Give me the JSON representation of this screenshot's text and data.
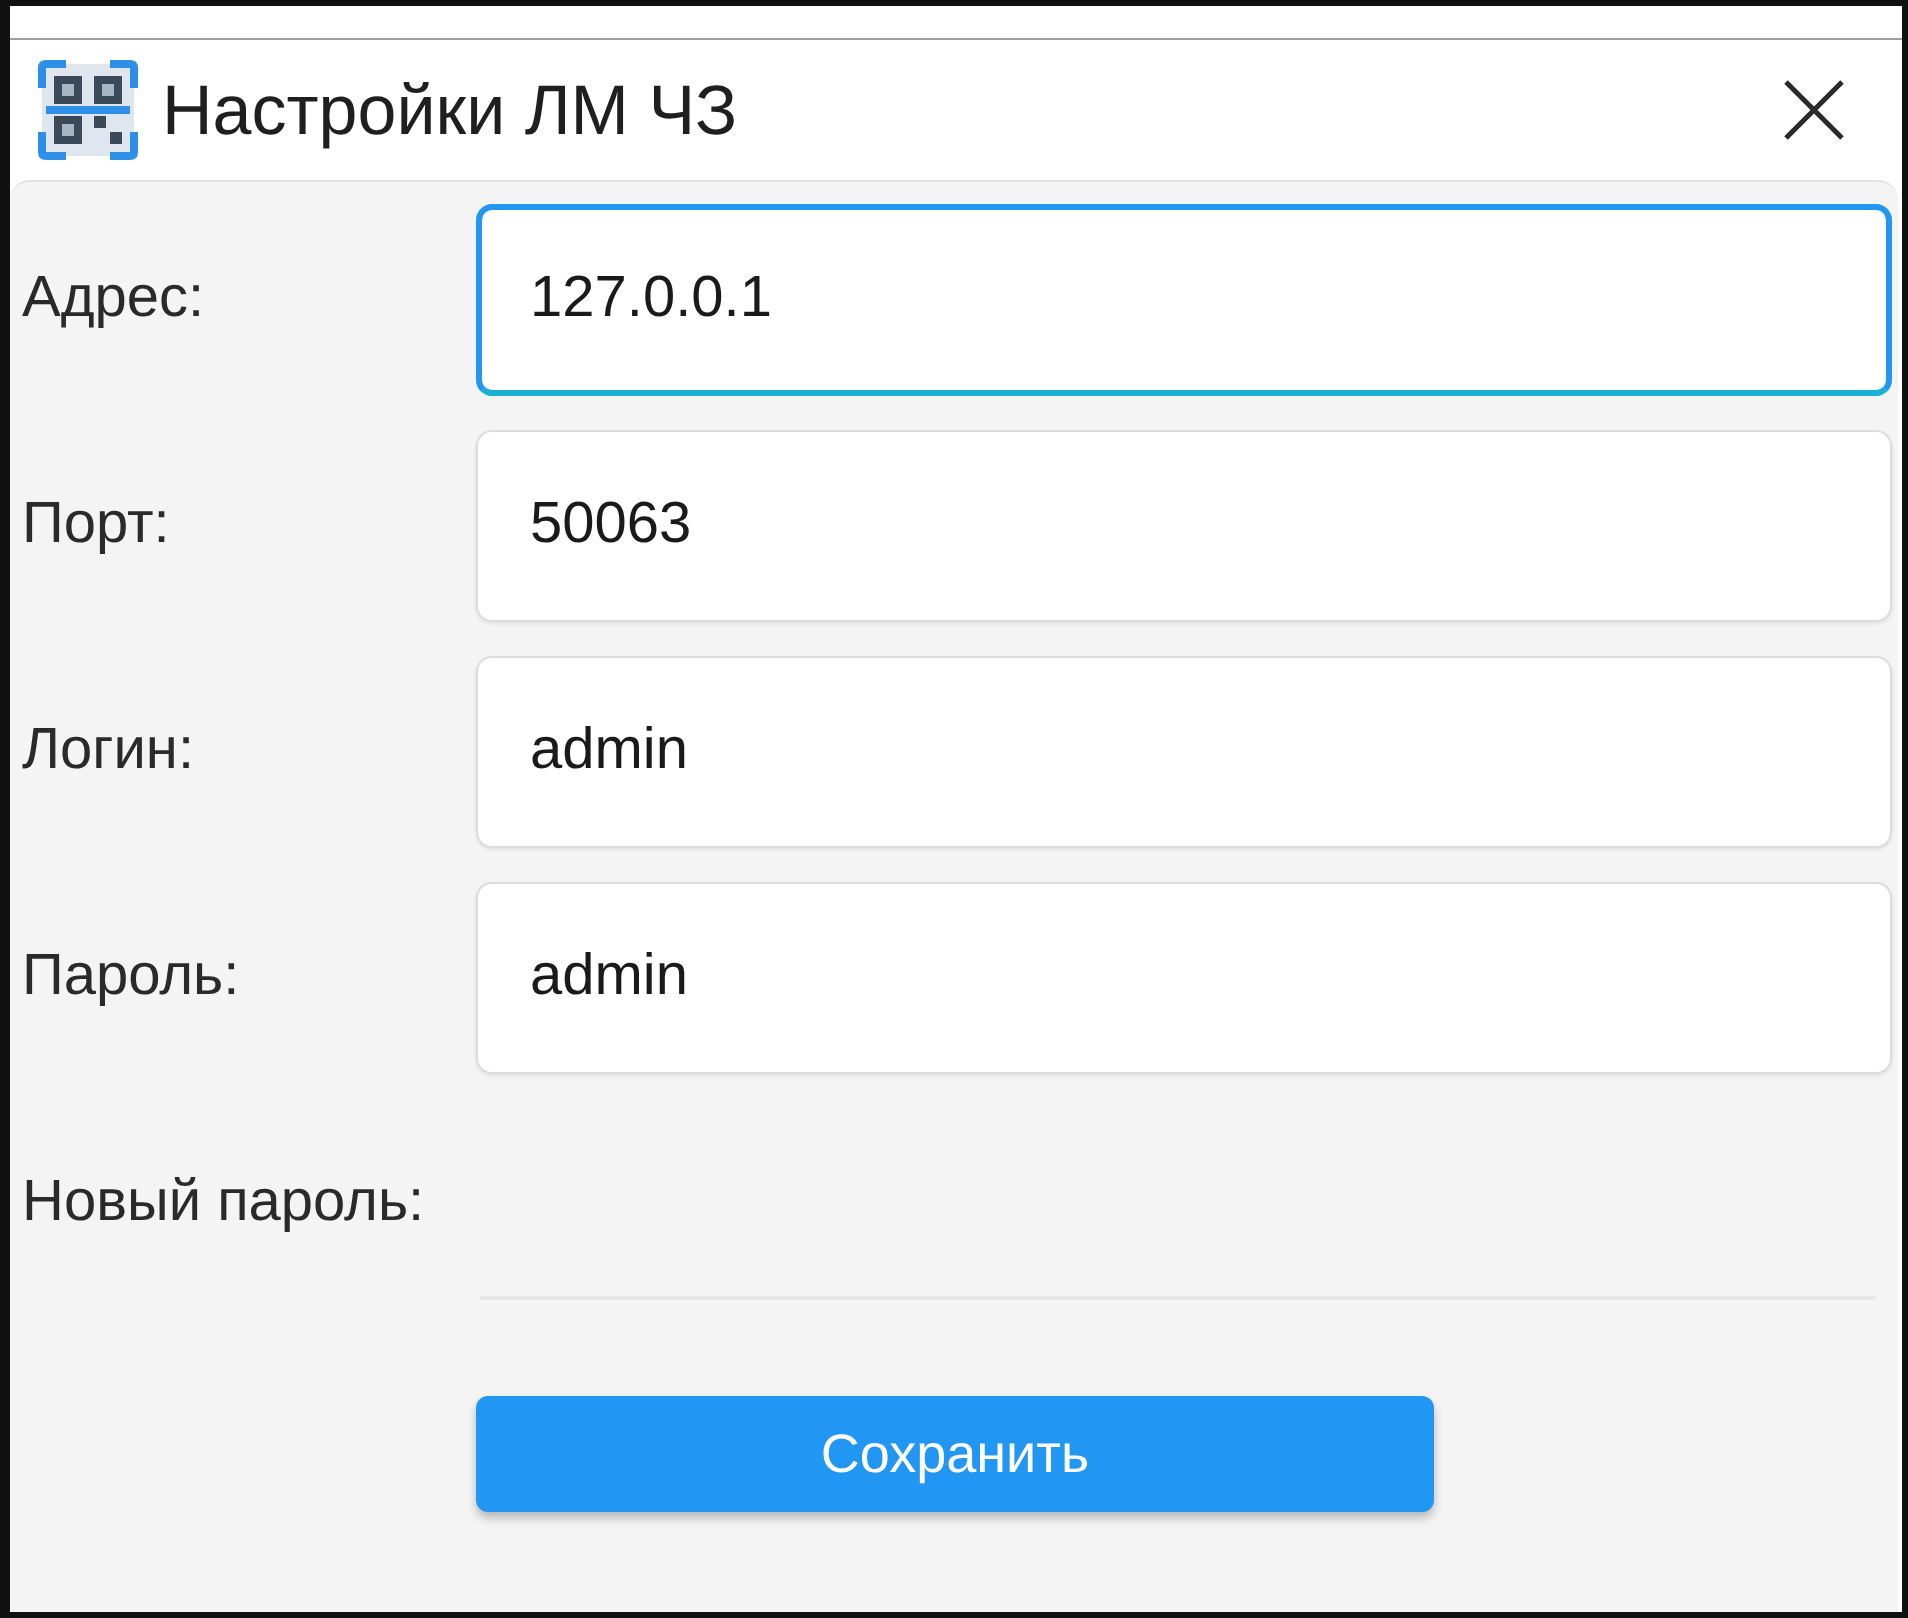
{
  "window": {
    "title": "Настройки ЛМ ЧЗ"
  },
  "fields": [
    {
      "label": "Адрес:",
      "value": "127.0.0.1",
      "kind": "outlined",
      "focused": true
    },
    {
      "label": "Порт:",
      "value": "50063",
      "kind": "outlined",
      "focused": false
    },
    {
      "label": "Логин:",
      "value": "admin",
      "kind": "outlined",
      "focused": false
    },
    {
      "label": "Пароль:",
      "value": "admin",
      "kind": "outlined",
      "focused": false
    },
    {
      "label": "Новый пароль:",
      "kind": "underlined",
      "focused": false
    }
  ],
  "buttons": [
    {
      "label": "Сохранить"
    }
  ]
}
